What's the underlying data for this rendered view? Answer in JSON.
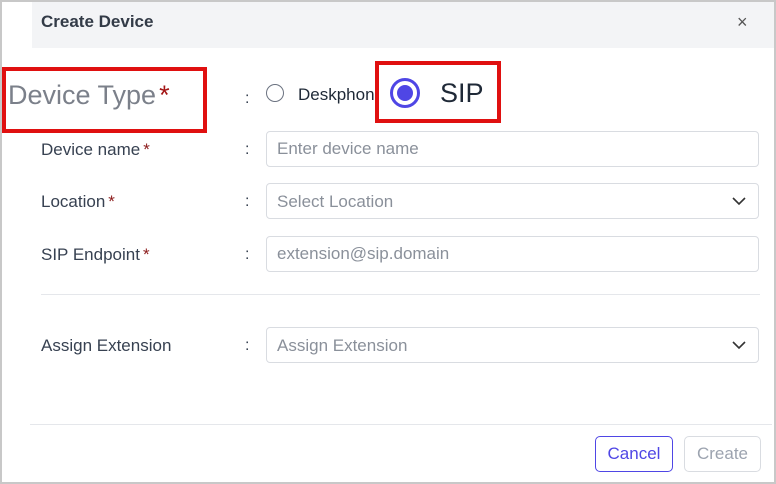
{
  "dialog": {
    "title": "Create Device",
    "close_glyph": "×"
  },
  "form": {
    "device_type": {
      "label": "Device Type",
      "required_mark": "*",
      "colon": ":",
      "options": [
        {
          "label": "Deskphone",
          "selected": false
        },
        {
          "label": "SIP",
          "selected": true
        }
      ]
    },
    "device_name": {
      "label": "Device name",
      "required_mark": "*",
      "colon": ":",
      "placeholder": "Enter device name",
      "value": ""
    },
    "location": {
      "label": "Location",
      "required_mark": "*",
      "colon": ":",
      "placeholder": "Select Location"
    },
    "sip_endpoint": {
      "label": "SIP Endpoint",
      "required_mark": "*",
      "colon": ":",
      "placeholder": "extension@sip.domain",
      "value": ""
    },
    "assign_extension": {
      "label": "Assign Extension",
      "colon": ":",
      "placeholder": "Assign Extension"
    }
  },
  "footer": {
    "cancel_label": "Cancel",
    "create_label": "Create"
  },
  "colors": {
    "accent": "#4f46e5",
    "required": "#8b1a1a",
    "highlight": "#e01010"
  },
  "icons": [
    "close-icon",
    "chevron-down-icon",
    "radio-icon"
  ]
}
